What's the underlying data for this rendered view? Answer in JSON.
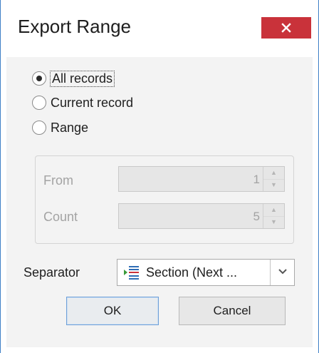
{
  "window": {
    "title": "Export Range"
  },
  "range_options": [
    {
      "label": "All records",
      "selected": true,
      "focused": true
    },
    {
      "label": "Current record",
      "selected": false,
      "focused": false
    },
    {
      "label": "Range",
      "selected": false,
      "focused": false
    }
  ],
  "range_group": {
    "from": {
      "label": "From",
      "value": "1",
      "enabled": false
    },
    "count": {
      "label": "Count",
      "value": "5",
      "enabled": false
    }
  },
  "separator": {
    "label": "Separator",
    "value": "Section (Next ...",
    "icon": "section-break-icon"
  },
  "buttons": {
    "ok": "OK",
    "cancel": "Cancel"
  },
  "colors": {
    "close_button": "#c9323a",
    "window_border": "#3f7fc6",
    "ok_button_border": "#6ea0d8",
    "disabled_text": "#a3a3a3",
    "section_icon_blue": "#2f6db5",
    "section_icon_green": "#3a9a3a"
  }
}
